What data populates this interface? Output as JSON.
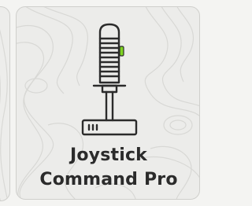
{
  "tile": {
    "title_line1": "Joystick",
    "title_line2": "Command Pro",
    "icon": "joystick-icon"
  },
  "colors": {
    "background": "#f4f4f2",
    "tile_background": "#ececea",
    "tile_border": "#cfcfcc",
    "text": "#2b2b2b",
    "icon_stroke": "#2b2b2b",
    "indicator": "#7ed321"
  }
}
